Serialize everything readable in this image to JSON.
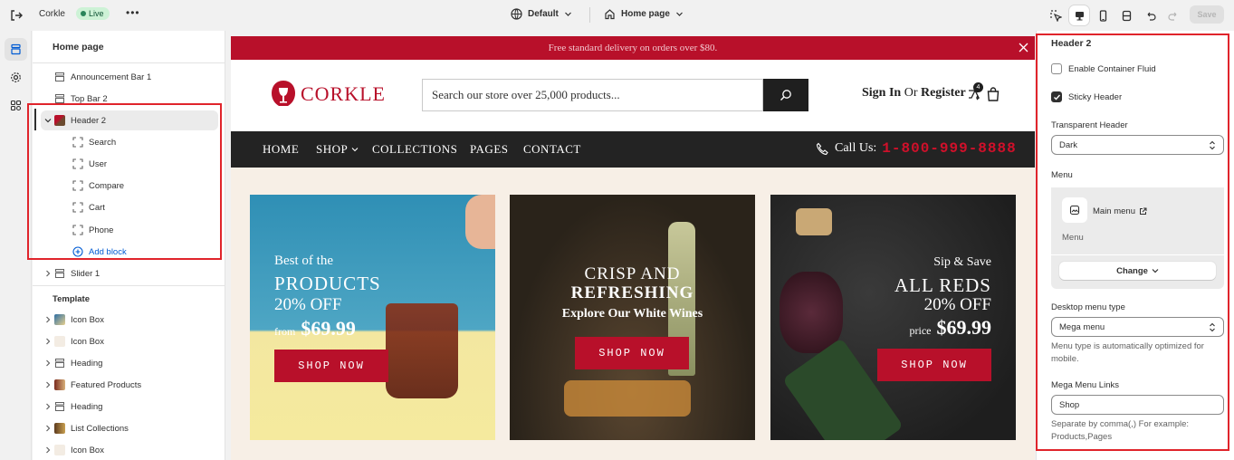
{
  "topbar": {
    "store_name": "Corkle",
    "live_badge": "Live",
    "more_label": "•••",
    "theme_label": "Default",
    "page_label": "Home page",
    "save_label": "Save"
  },
  "left_panel": {
    "title": "Home page",
    "header_sections": [
      {
        "label": "Announcement Bar 1"
      },
      {
        "label": "Top Bar 2"
      },
      {
        "label": "Header 2"
      }
    ],
    "header2_blocks": [
      {
        "label": "Search"
      },
      {
        "label": "User"
      },
      {
        "label": "Compare"
      },
      {
        "label": "Cart"
      },
      {
        "label": "Phone"
      }
    ],
    "add_block_label": "Add block",
    "slider_label": "Slider 1",
    "template_heading": "Template",
    "template_sections": [
      {
        "label": "Icon Box"
      },
      {
        "label": "Icon Box"
      },
      {
        "label": "Heading"
      },
      {
        "label": "Featured Products"
      },
      {
        "label": "Heading"
      },
      {
        "label": "List Collections"
      },
      {
        "label": "Icon Box"
      }
    ]
  },
  "storefront": {
    "announcement": "Free standard delivery on orders over $80.",
    "logo_text": "CORKLE",
    "search_placeholder": "Search our store over 25,000 products...",
    "sign_in": "Sign In",
    "or": "Or",
    "register": "Register",
    "compare_count": "4",
    "nav": [
      "HOME",
      "SHOP",
      "COLLECTIONS",
      "PAGES",
      "CONTACT"
    ],
    "call_label": "Call Us:",
    "phone": "1-800-999-8888",
    "banners": [
      {
        "line1": "Best of the",
        "line2": "PRODUCTS",
        "line3": "20% OFF",
        "from": "from",
        "price": "$69.99",
        "cta": "SHOP NOW"
      },
      {
        "line1": "CRISP AND",
        "line2": "REFRESHING",
        "line3": "Explore Our White Wines",
        "cta": "SHOP NOW"
      },
      {
        "line1": "Sip & Save",
        "line2": "ALL REDS",
        "line3": "20% OFF",
        "from": "price",
        "price": "$69.99",
        "cta": "SHOP NOW"
      }
    ]
  },
  "right_panel": {
    "title": "Header 2",
    "enable_container_fluid": {
      "label": "Enable Container Fluid",
      "checked": false
    },
    "sticky_header": {
      "label": "Sticky Header",
      "checked": true
    },
    "transparent_header_label": "Transparent Header",
    "transparent_header_value": "Dark",
    "menu_label": "Menu",
    "menu_name": "Main menu",
    "menu_sub": "Menu",
    "change_label": "Change",
    "desktop_menu_type_label": "Desktop menu type",
    "desktop_menu_type_value": "Mega menu",
    "desktop_menu_help": "Menu type is automatically optimized for mobile.",
    "mega_menu_links_label": "Mega Menu Links",
    "mega_menu_links_value": "Shop",
    "mega_menu_help": "Separate by comma(,) For example: Products,Pages"
  },
  "colors": {
    "brand_red": "#b8102a",
    "highlight_box": "#e0242b",
    "nav_bg": "#232323"
  }
}
